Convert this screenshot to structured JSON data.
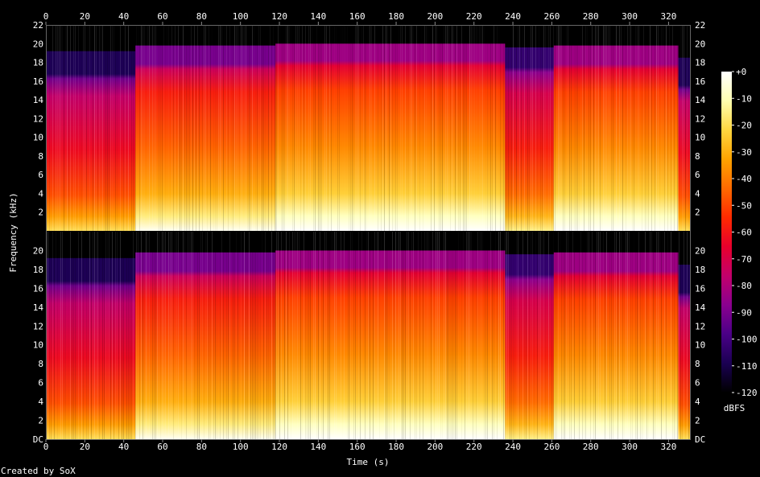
{
  "chart_data": {
    "type": "heatmap",
    "xlabel": "Time (s)",
    "ylabel": "Frequency (kHz)",
    "footer": "Created by SoX",
    "colorbar_label": "dBFS",
    "x_range": [
      0,
      331
    ],
    "y_range_khz": [
      0,
      22
    ],
    "x_ticks": [
      "0",
      "20",
      "40",
      "60",
      "80",
      "100",
      "120",
      "140",
      "160",
      "180",
      "200",
      "220",
      "240",
      "260",
      "280",
      "300",
      "320"
    ],
    "y_ticks_top": [
      "2",
      "4",
      "6",
      "8",
      "10",
      "12",
      "14",
      "16",
      "18",
      "20",
      "22"
    ],
    "y_ticks_bottom": [
      "DC",
      "2",
      "4",
      "6",
      "8",
      "10",
      "12",
      "14",
      "16",
      "18",
      "20"
    ],
    "colorbar_ticks": [
      "+0",
      "-10",
      "-20",
      "-30",
      "-40",
      "-50",
      "-60",
      "-70",
      "-80",
      "-90",
      "-100",
      "-110",
      "-120"
    ],
    "colorbar_range_db": [
      -120,
      0
    ],
    "colormap": [
      "#000000",
      "#1a0052",
      "#4a0087",
      "#8a008f",
      "#c2006b",
      "#e8002c",
      "#ff2a00",
      "#ff6a00",
      "#ffa300",
      "#ffd640",
      "#ffffb0",
      "#ffffff"
    ],
    "channels": 2,
    "segments": [
      {
        "t_start": 0,
        "t_end": 46,
        "level_db": -70,
        "cutoff_khz": 19.2
      },
      {
        "t_start": 46,
        "t_end": 118,
        "level_db": -52,
        "cutoff_khz": 19.8
      },
      {
        "t_start": 118,
        "t_end": 236,
        "level_db": -45,
        "cutoff_khz": 20.0
      },
      {
        "t_start": 236,
        "t_end": 261,
        "level_db": -65,
        "cutoff_khz": 19.6
      },
      {
        "t_start": 261,
        "t_end": 325,
        "level_db": -45,
        "cutoff_khz": 19.8
      },
      {
        "t_start": 325,
        "t_end": 331,
        "level_db": -70,
        "cutoff_khz": 18.5
      }
    ]
  }
}
